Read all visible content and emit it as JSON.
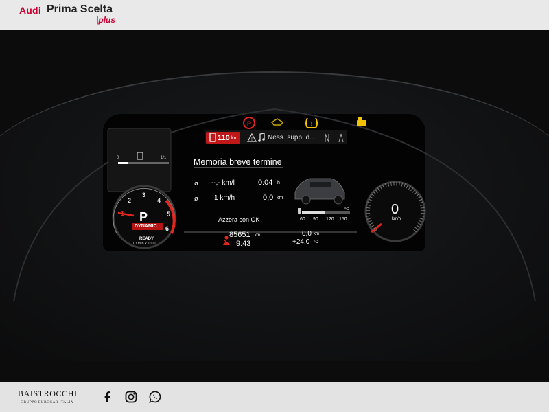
{
  "header": {
    "brand_audi": "Audi",
    "brand_prima": "Prima Scelta",
    "brand_plus": "|plus"
  },
  "footer": {
    "logo": "BAISTROCCHI",
    "sub": "GRUPPO EUROCAR ITALIA",
    "social_icons": [
      "facebook-icon",
      "instagram-icon",
      "whatsapp-icon"
    ]
  },
  "cluster": {
    "range_badge": "110",
    "range_unit": "km",
    "media_text": "Ness. supp. d...",
    "fuel_scale_min": "0",
    "fuel_scale_max": "1/1",
    "tacho": {
      "gear": "P",
      "mode": "DYNAMIC",
      "status": "READY",
      "unit": "1 / min x 1000",
      "ticks": [
        "1",
        "2",
        "3",
        "4",
        "5",
        "6"
      ]
    },
    "trip": {
      "title": "Memoria breve termine",
      "symbol_1": "ø",
      "consumption": "--,- km/l",
      "time": "0:04",
      "time_unit": "h",
      "symbol_2": "ø",
      "speed_avg": "1 km/h",
      "distance": "0,0",
      "distance_unit": "km",
      "reset": "Azzera con OK"
    },
    "temp_scale": [
      "60",
      "90",
      "120",
      "150"
    ],
    "temp_unit": "°C",
    "odometer": "85651",
    "odometer_unit": "km",
    "clock": "9:43",
    "trip_km": "0,0",
    "trip_km_unit": "km",
    "outside_temp": "+24,0",
    "outside_temp_unit": "°C",
    "speed": "0",
    "speed_unit": "km/h",
    "colors": {
      "red_accent": "#e0261d",
      "yellow_warning": "#f2c200",
      "screen_bg": "#030303"
    }
  }
}
